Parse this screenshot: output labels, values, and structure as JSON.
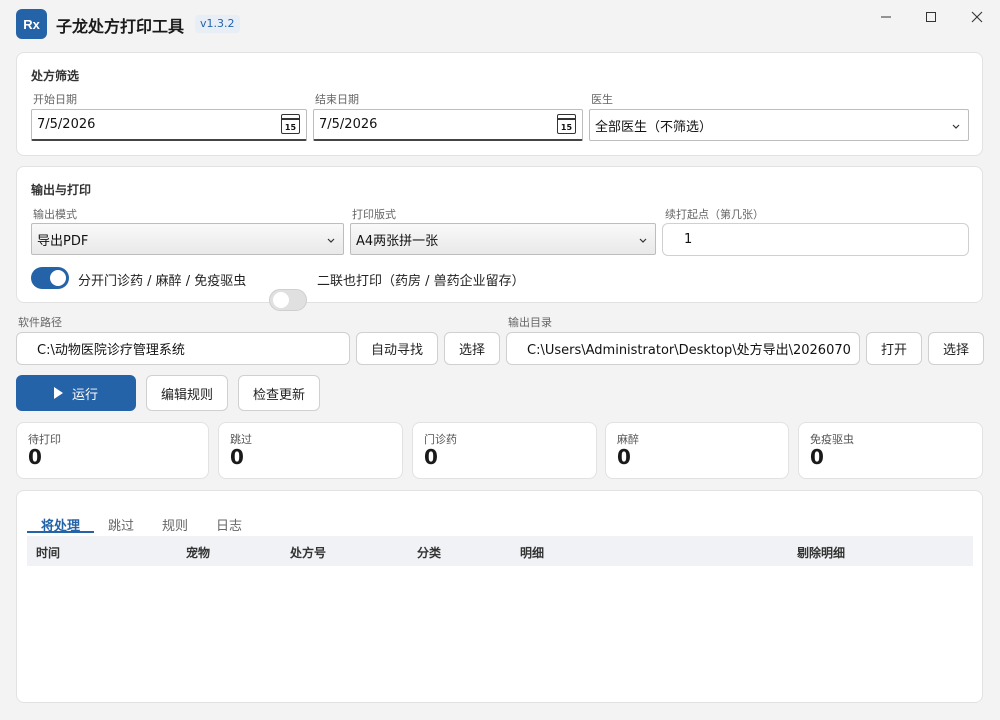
{
  "app": {
    "logo_text": "Rx",
    "title": "子龙处方打印工具",
    "version": "v1.3.2"
  },
  "window": {
    "minimize": "—",
    "maximize": "☐",
    "close": "✕"
  },
  "filter": {
    "section_title": "处方筛选",
    "start_date_label": "开始日期",
    "start_date_value": "7/5/2026",
    "end_date_label": "结束日期",
    "end_date_value": "7/5/2026",
    "calendar_day": "15",
    "doctor_label": "医生",
    "doctor_value": "全部医生（不筛选）"
  },
  "output": {
    "section_title": "输出与打印",
    "mode_label": "输出模式",
    "mode_value": "导出PDF",
    "layout_label": "打印版式",
    "layout_value": "A4两张拼一张",
    "resume_label": "续打起点（第几张）",
    "resume_value": "1",
    "toggle1_label": "分开门诊药 / 麻醉 / 免疫驱虫",
    "toggle1_on": true,
    "toggle2_label": "二联也打印（药房 / 兽药企业留存）",
    "toggle2_on": false
  },
  "paths": {
    "software_label": "软件路径",
    "software_value": "C:\\动物医院诊疗管理系统",
    "auto_find": "自动寻找",
    "select1": "选择",
    "output_label": "输出目录",
    "output_value": "C:\\Users\\Administrator\\Desktop\\处方导出\\2026070",
    "open": "打开",
    "select2": "选择"
  },
  "actions": {
    "run": "运行",
    "edit_rules": "编辑规则",
    "check_update": "检查更新"
  },
  "stats": [
    {
      "label": "待打印",
      "value": "0"
    },
    {
      "label": "跳过",
      "value": "0"
    },
    {
      "label": "门诊药",
      "value": "0"
    },
    {
      "label": "麻醉",
      "value": "0"
    },
    {
      "label": "免疫驱虫",
      "value": "0"
    }
  ],
  "tabs": [
    "将处理",
    "跳过",
    "规则",
    "日志"
  ],
  "table": {
    "columns": [
      "时间",
      "宠物",
      "处方号",
      "分类",
      "明细",
      "剔除明细"
    ]
  },
  "colors": {
    "accent": "#2563a8",
    "background": "#f3f3f3"
  }
}
